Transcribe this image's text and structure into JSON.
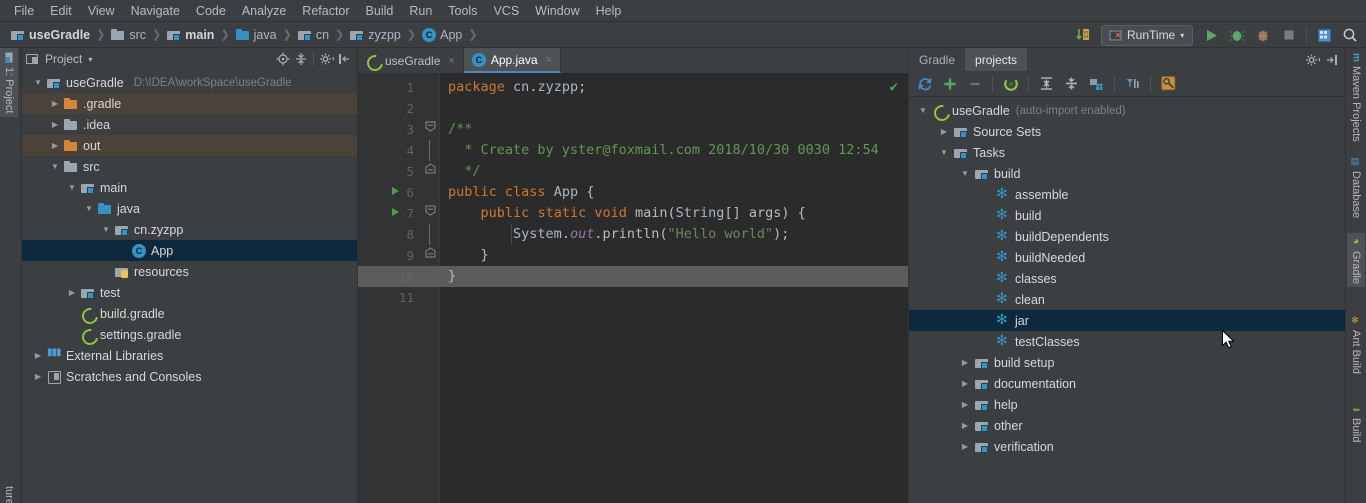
{
  "menu": {
    "items": [
      "File",
      "Edit",
      "View",
      "Navigate",
      "Code",
      "Analyze",
      "Refactor",
      "Build",
      "Run",
      "Tools",
      "VCS",
      "Window",
      "Help"
    ]
  },
  "breadcrumb": {
    "items": [
      {
        "label": "useGradle",
        "icon": "module-icon",
        "bold": true
      },
      {
        "label": "src",
        "icon": "folder-icon",
        "bold": false
      },
      {
        "label": "main",
        "icon": "module-icon",
        "bold": true
      },
      {
        "label": "java",
        "icon": "source-folder-icon",
        "bold": false
      },
      {
        "label": "cn",
        "icon": "package-icon",
        "bold": false
      },
      {
        "label": "zyzpp",
        "icon": "package-icon",
        "bold": false
      },
      {
        "label": "App",
        "icon": "class-icon",
        "bold": false
      }
    ]
  },
  "toolbar": {
    "compile_icon": "compile-icon",
    "run_config": {
      "label": "RunTime",
      "icon": "run-config-icon",
      "dropdown": "▾"
    },
    "run_icon": "run-icon",
    "debug_icon": "debug-icon",
    "coverage_icon": "run-with-coverage-icon",
    "stop_icon": "stop-icon",
    "updates_icon": "updates-icon",
    "search_icon": "search-everywhere-icon"
  },
  "left_strip": {
    "items": [
      {
        "label": "1: Project",
        "icon": "project-icon",
        "active": true
      },
      {
        "label": "ture",
        "icon": "structure-icon",
        "active": false
      }
    ]
  },
  "right_strip": {
    "items": [
      {
        "label": "Maven Projects",
        "icon": "maven-icon"
      },
      {
        "label": "Database",
        "icon": "database-icon"
      },
      {
        "label": "Gradle",
        "icon": "gradle-icon"
      },
      {
        "label": "Ant Build",
        "icon": "ant-icon"
      },
      {
        "label": "Build",
        "icon": "build-icon"
      }
    ]
  },
  "project_panel": {
    "title": "Project",
    "dropdown": "▾",
    "header_icons": [
      "locate-icon",
      "collapse-all-icon",
      "settings-gear-icon",
      "hide-panel-icon"
    ],
    "tree": [
      {
        "label": "useGradle",
        "path": "D:\\IDEA\\workSpace\\useGradle",
        "indent": 0,
        "arrow": "open",
        "icon": "module-icon",
        "state": "normal"
      },
      {
        "label": ".gradle",
        "path": "",
        "indent": 1,
        "arrow": "closed",
        "icon": "folder-orange-icon",
        "state": "excluded"
      },
      {
        "label": ".idea",
        "path": "",
        "indent": 1,
        "arrow": "closed",
        "icon": "folder-icon",
        "state": "normal"
      },
      {
        "label": "out",
        "path": "",
        "indent": 1,
        "arrow": "closed",
        "icon": "folder-orange-icon",
        "state": "excluded"
      },
      {
        "label": "src",
        "path": "",
        "indent": 1,
        "arrow": "open",
        "icon": "folder-icon",
        "state": "normal"
      },
      {
        "label": "main",
        "path": "",
        "indent": 2,
        "arrow": "open",
        "icon": "module-icon",
        "state": "normal"
      },
      {
        "label": "java",
        "path": "",
        "indent": 3,
        "arrow": "open",
        "icon": "folder-blue-icon",
        "state": "normal"
      },
      {
        "label": "cn.zyzpp",
        "path": "",
        "indent": 4,
        "arrow": "open",
        "icon": "package-icon",
        "state": "normal"
      },
      {
        "label": "App",
        "path": "",
        "indent": 5,
        "arrow": "none",
        "icon": "class-icon",
        "state": "selected"
      },
      {
        "label": "resources",
        "path": "",
        "indent": 4,
        "arrow": "none",
        "icon": "resources-icon",
        "state": "normal"
      },
      {
        "label": "test",
        "path": "",
        "indent": 2,
        "arrow": "closed",
        "icon": "module-icon",
        "state": "normal"
      },
      {
        "label": "build.gradle",
        "path": "",
        "indent": 2,
        "arrow": "none",
        "icon": "gradle-file-icon",
        "state": "normal"
      },
      {
        "label": "settings.gradle",
        "path": "",
        "indent": 2,
        "arrow": "none",
        "icon": "gradle-file-icon",
        "state": "normal"
      },
      {
        "label": "External Libraries",
        "path": "",
        "indent": 0,
        "arrow": "closed",
        "icon": "libraries-icon",
        "state": "normal"
      },
      {
        "label": "Scratches and Consoles",
        "path": "",
        "indent": 0,
        "arrow": "closed",
        "icon": "scratches-icon",
        "state": "normal"
      }
    ]
  },
  "editor": {
    "tabs": [
      {
        "label": "useGradle",
        "icon": "gradle-file-icon",
        "active": false,
        "close": "×"
      },
      {
        "label": "App.java",
        "icon": "class-icon",
        "active": true,
        "close": "×"
      }
    ],
    "inspection_status": "✔",
    "caret_line": 10,
    "lines": [
      {
        "n": 1,
        "html": "<span class=\"kw\">package</span> <span class=\"pkg\">cn</span>.<span class=\"pkg\">zyzpp</span>;",
        "gutter_run": false,
        "fold": "none"
      },
      {
        "n": 2,
        "html": "",
        "gutter_run": false,
        "fold": "none"
      },
      {
        "n": 3,
        "html": "<span class=\"cmt\">/**</span>",
        "gutter_run": false,
        "fold": "start"
      },
      {
        "n": 4,
        "html": "<span class=\"cmt\">  * Create by yster@foxmail.com 2018/10/30 0030 12:54</span>",
        "gutter_run": false,
        "fold": "mid"
      },
      {
        "n": 5,
        "html": "<span class=\"cmt\">  */</span>",
        "gutter_run": false,
        "fold": "end"
      },
      {
        "n": 6,
        "html": "<span class=\"kw\">public</span> <span class=\"kw\">class</span> <span class=\"cname\">App</span> {",
        "gutter_run": true,
        "fold": "none"
      },
      {
        "n": 7,
        "html": "    <span class=\"kw\">public</span> <span class=\"kw\">static</span> <span class=\"kw\">void</span> main(<span class=\"typ\">String</span>[] args) {",
        "gutter_run": true,
        "fold": "start2"
      },
      {
        "n": 8,
        "html": "        <span class=\"cls2\">System</span>.<span class=\"fld\">out</span>.println(<span class=\"str\">\"Hello world\"</span>);",
        "gutter_run": false,
        "fold": "mid2"
      },
      {
        "n": 9,
        "html": "    }",
        "gutter_run": false,
        "fold": "end2"
      },
      {
        "n": 10,
        "html": "}",
        "gutter_run": false,
        "fold": "none"
      },
      {
        "n": 11,
        "html": "",
        "gutter_run": false,
        "fold": "none"
      }
    ]
  },
  "gradle_panel": {
    "tabs": [
      {
        "label": "Gradle",
        "active": false
      },
      {
        "label": "projects",
        "active": true
      }
    ],
    "header_icons": [
      "settings-gear-icon",
      "hide-panel-icon"
    ],
    "toolbar_icons": [
      "refresh-all-projects-icon",
      "attach-gradle-project-icon",
      "detach-project-icon",
      "execute-gradle-task-icon",
      "expand-all-icon",
      "collapse-all-icon",
      "toggle-offline-mode-icon",
      "filter-tasks-icon",
      "gradle-settings-icon"
    ],
    "tree": [
      {
        "label": "useGradle",
        "suffix": "(auto-import enabled)",
        "indent": 0,
        "arrow": "open",
        "icon": "gradle-icon",
        "state": "normal"
      },
      {
        "label": "Source Sets",
        "suffix": "",
        "indent": 1,
        "arrow": "closed",
        "icon": "source-sets-icon",
        "state": "normal"
      },
      {
        "label": "Tasks",
        "suffix": "",
        "indent": 1,
        "arrow": "open",
        "icon": "tasks-folder-icon",
        "state": "normal"
      },
      {
        "label": "build",
        "suffix": "",
        "indent": 2,
        "arrow": "open",
        "icon": "tasks-folder-icon",
        "state": "normal"
      },
      {
        "label": "assemble",
        "suffix": "",
        "indent": 3,
        "arrow": "none",
        "icon": "gradle-task-icon",
        "state": "normal"
      },
      {
        "label": "build",
        "suffix": "",
        "indent": 3,
        "arrow": "none",
        "icon": "gradle-task-icon",
        "state": "normal"
      },
      {
        "label": "buildDependents",
        "suffix": "",
        "indent": 3,
        "arrow": "none",
        "icon": "gradle-task-icon",
        "state": "normal"
      },
      {
        "label": "buildNeeded",
        "suffix": "",
        "indent": 3,
        "arrow": "none",
        "icon": "gradle-task-icon",
        "state": "normal"
      },
      {
        "label": "classes",
        "suffix": "",
        "indent": 3,
        "arrow": "none",
        "icon": "gradle-task-icon",
        "state": "normal"
      },
      {
        "label": "clean",
        "suffix": "",
        "indent": 3,
        "arrow": "none",
        "icon": "gradle-task-icon",
        "state": "normal"
      },
      {
        "label": "jar",
        "suffix": "",
        "indent": 3,
        "arrow": "none",
        "icon": "gradle-task-icon",
        "state": "selected"
      },
      {
        "label": "testClasses",
        "suffix": "",
        "indent": 3,
        "arrow": "none",
        "icon": "gradle-task-icon",
        "state": "normal"
      },
      {
        "label": "build setup",
        "suffix": "",
        "indent": 2,
        "arrow": "closed",
        "icon": "tasks-folder-icon",
        "state": "normal"
      },
      {
        "label": "documentation",
        "suffix": "",
        "indent": 2,
        "arrow": "closed",
        "icon": "tasks-folder-icon",
        "state": "normal"
      },
      {
        "label": "help",
        "suffix": "",
        "indent": 2,
        "arrow": "closed",
        "icon": "tasks-folder-icon",
        "state": "normal"
      },
      {
        "label": "other",
        "suffix": "",
        "indent": 2,
        "arrow": "closed",
        "icon": "tasks-folder-icon",
        "state": "normal"
      },
      {
        "label": "verification",
        "suffix": "",
        "indent": 2,
        "arrow": "closed",
        "icon": "tasks-folder-icon",
        "state": "normal"
      }
    ]
  },
  "colors": {
    "chrome_bg": "#3c3f41",
    "editor_bg": "#2b2b2b",
    "gutter_bg": "#313335",
    "selection_blue": "#0d293e",
    "excluded_row": "#4b423a",
    "accent_blue": "#4a88c7",
    "caret_line": "#5b5c5b"
  }
}
